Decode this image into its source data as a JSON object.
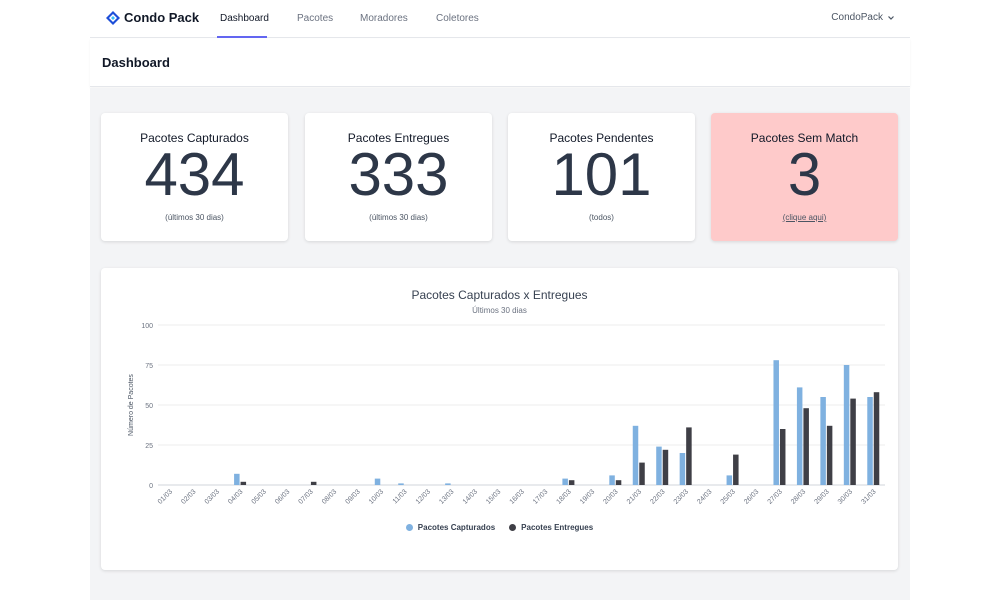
{
  "app": {
    "name": "Condo Pack"
  },
  "nav": {
    "items": [
      {
        "label": "Dashboard",
        "active": true
      },
      {
        "label": "Pacotes",
        "active": false
      },
      {
        "label": "Moradores",
        "active": false
      },
      {
        "label": "Coletores",
        "active": false
      }
    ],
    "user": "CondoPack"
  },
  "header": {
    "title": "Dashboard"
  },
  "cards": [
    {
      "title": "Pacotes Capturados",
      "value": "434",
      "sub": "(últimos 30 dias)"
    },
    {
      "title": "Pacotes Entregues",
      "value": "333",
      "sub": "(últimos 30 dias)"
    },
    {
      "title": "Pacotes Pendentes",
      "value": "101",
      "sub": "(todos)"
    },
    {
      "title": "Pacotes Sem Match",
      "value": "3",
      "sub": "(clique aqui)"
    }
  ],
  "colors": {
    "alert_card": "#fecaca",
    "captured": "#7fb1e0",
    "delivered": "#3f3f46",
    "accent": "#6366f1"
  },
  "chart_data": {
    "type": "bar",
    "title": "Pacotes Capturados x Entregues",
    "subtitle": "Últimos 30 dias",
    "xlabel": "",
    "ylabel": "Número de Pacotes",
    "ylim": [
      0,
      100
    ],
    "yticks": [
      0,
      25,
      50,
      75,
      100
    ],
    "grid": true,
    "legend": "bottom",
    "categories": [
      "01/03",
      "02/03",
      "03/03",
      "04/03",
      "05/03",
      "06/03",
      "07/03",
      "08/03",
      "09/03",
      "10/03",
      "11/03",
      "12/03",
      "13/03",
      "14/03",
      "15/03",
      "16/03",
      "17/03",
      "18/03",
      "19/03",
      "20/03",
      "21/03",
      "22/03",
      "23/03",
      "24/03",
      "25/03",
      "26/03",
      "27/03",
      "28/03",
      "29/03",
      "30/03",
      "31/03"
    ],
    "series": [
      {
        "name": "Pacotes Capturados",
        "color": "#7fb1e0",
        "values": [
          0,
          0,
          0,
          7,
          0,
          0,
          0,
          0,
          0,
          4,
          1,
          0,
          1,
          0,
          0,
          0,
          0,
          4,
          0,
          6,
          37,
          24,
          20,
          0,
          6,
          0,
          78,
          61,
          55,
          75,
          55
        ]
      },
      {
        "name": "Pacotes Entregues",
        "color": "#3f3f46",
        "values": [
          0,
          0,
          0,
          2,
          0,
          0,
          2,
          0,
          0,
          0,
          0,
          0,
          0,
          0,
          0,
          0,
          0,
          3,
          0,
          3,
          14,
          22,
          36,
          0,
          19,
          0,
          35,
          48,
          37,
          54,
          58
        ]
      }
    ]
  }
}
